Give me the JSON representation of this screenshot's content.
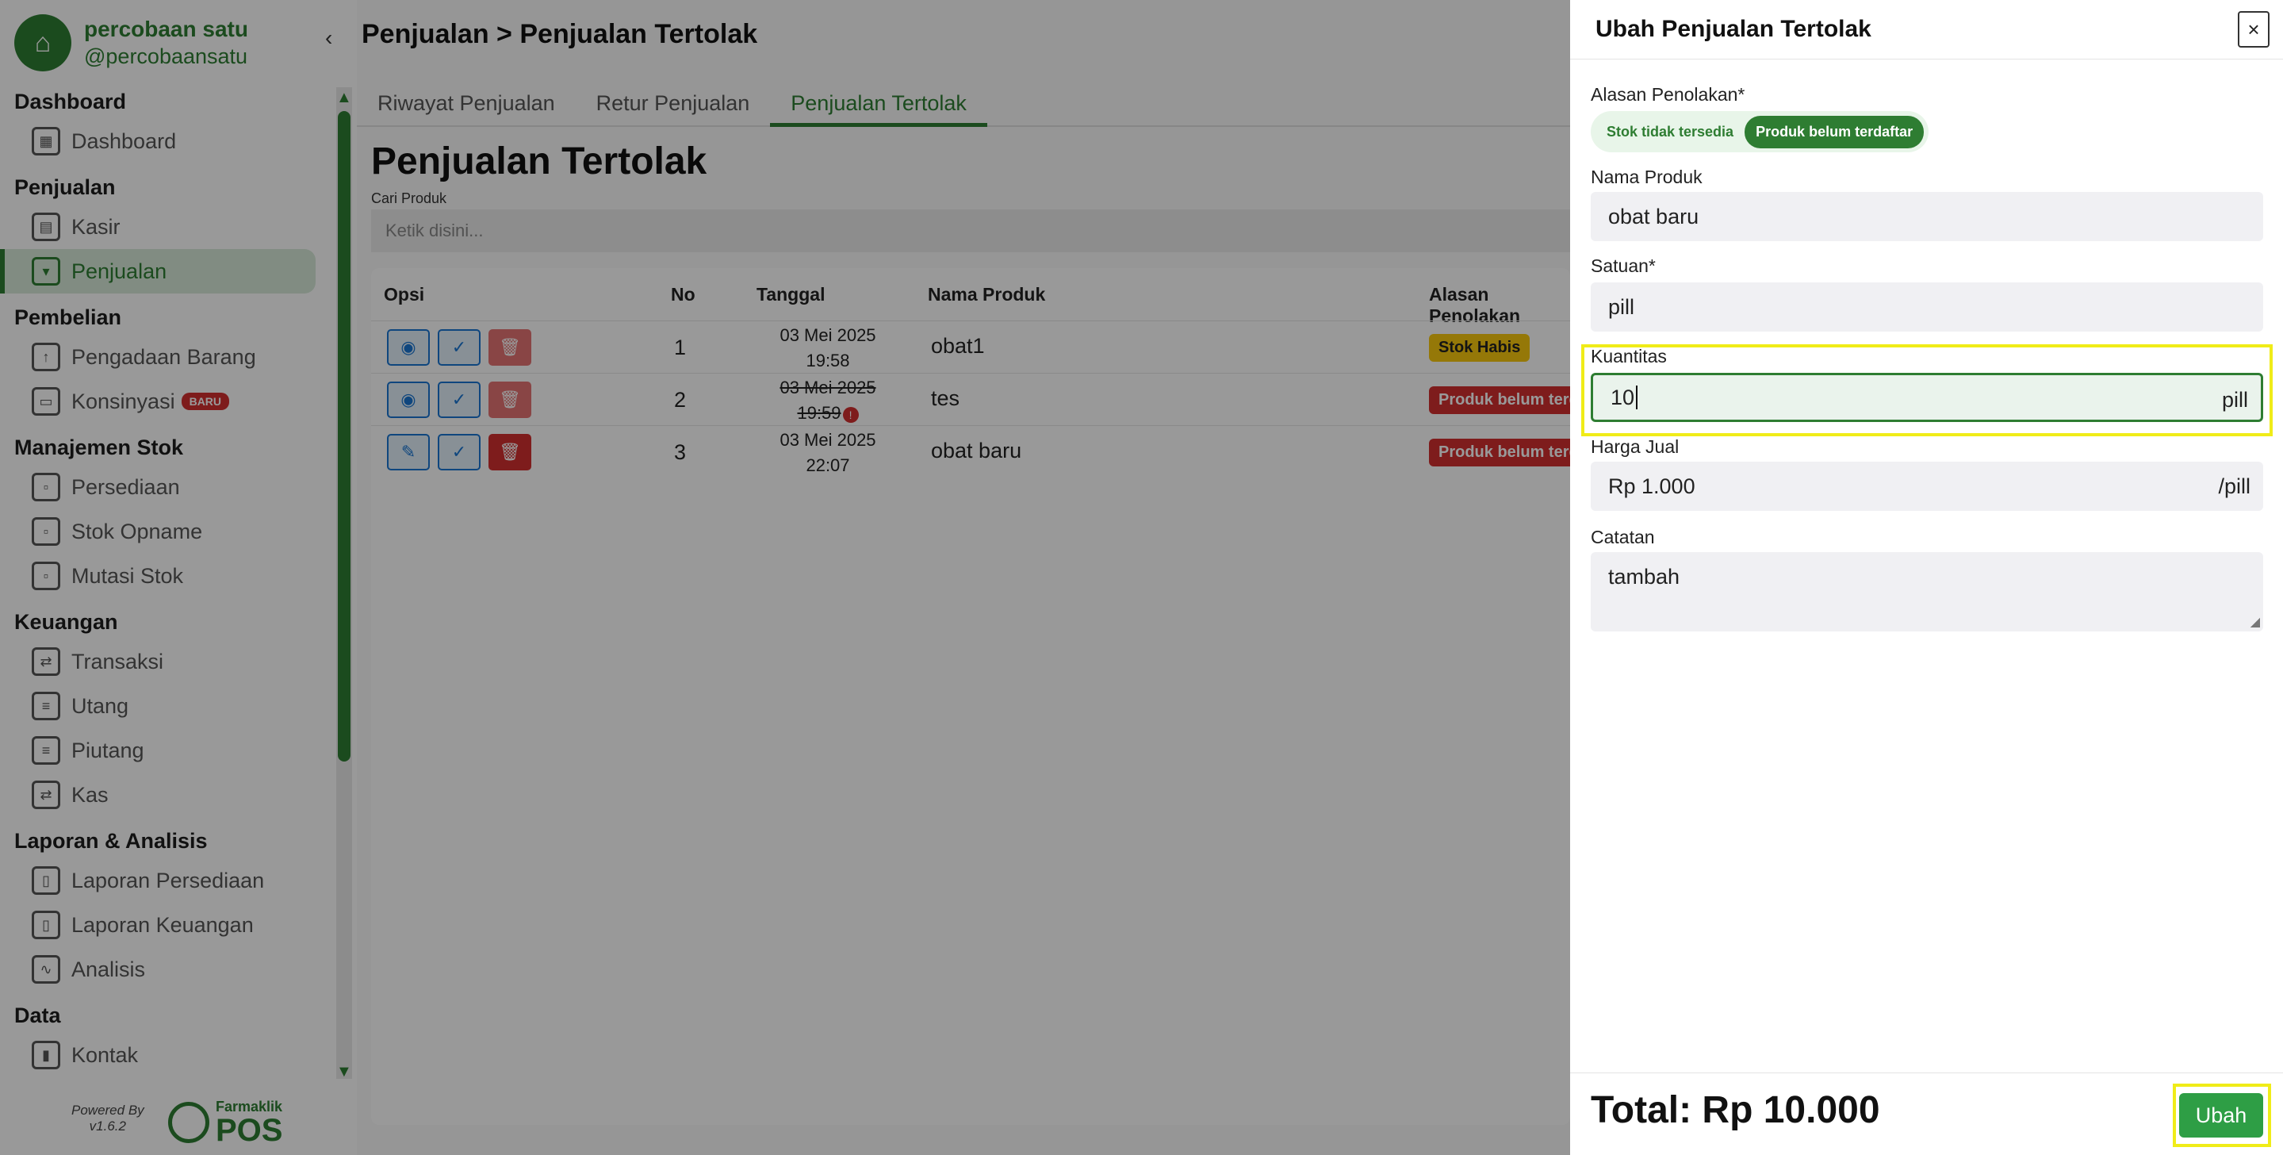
{
  "brand": {
    "name": "percobaan satu",
    "handle": "@percobaansatu"
  },
  "sidebar": {
    "groups": [
      {
        "title": "Dashboard",
        "items": [
          {
            "label": "Dashboard"
          }
        ]
      },
      {
        "title": "Penjualan",
        "items": [
          {
            "label": "Kasir"
          },
          {
            "label": "Penjualan",
            "active": true
          }
        ]
      },
      {
        "title": "Pembelian",
        "items": [
          {
            "label": "Pengadaan Barang"
          },
          {
            "label": "Konsinyasi",
            "badge": "BARU"
          }
        ]
      },
      {
        "title": "Manajemen Stok",
        "items": [
          {
            "label": "Persediaan"
          },
          {
            "label": "Stok Opname"
          },
          {
            "label": "Mutasi Stok"
          }
        ]
      },
      {
        "title": "Keuangan",
        "items": [
          {
            "label": "Transaksi"
          },
          {
            "label": "Utang"
          },
          {
            "label": "Piutang"
          },
          {
            "label": "Kas"
          }
        ]
      },
      {
        "title": "Laporan & Analisis",
        "items": [
          {
            "label": "Laporan Persediaan"
          },
          {
            "label": "Laporan Keuangan"
          },
          {
            "label": "Analisis"
          }
        ]
      },
      {
        "title": "Data",
        "items": [
          {
            "label": "Kontak"
          }
        ]
      }
    ],
    "powered_by": "Powered By",
    "version": "v1.6.2",
    "powered_logo_top": "Farmaklik",
    "powered_logo_bottom": "POS"
  },
  "header": {
    "breadcrumb": "Penjualan > Penjualan Tertolak"
  },
  "tabs": [
    {
      "label": "Riwayat Penjualan"
    },
    {
      "label": "Retur Penjualan"
    },
    {
      "label": "Penjualan Tertolak",
      "active": true
    }
  ],
  "main": {
    "title": "Penjualan Tertolak",
    "search_label": "Cari Produk",
    "search_placeholder": "Ketik disini..."
  },
  "table": {
    "headers": {
      "opsi": "Opsi",
      "no": "No",
      "tanggal": "Tanggal",
      "nama": "Nama Produk",
      "alasan": "Alasan Penolakan"
    },
    "rows": [
      {
        "no": "1",
        "date": "03 Mei 2025",
        "time": "19:58",
        "name": "obat1",
        "reason": "Stok Habis",
        "reason_color": "#f9c80e"
      },
      {
        "no": "2",
        "date": "03 Mei 2025",
        "time": "19:59",
        "name": "tes",
        "reason": "Produk belum terdaftar",
        "reason_color": "#d32f2f"
      },
      {
        "no": "3",
        "date": "03 Mei 2025",
        "time": "22:07",
        "name": "obat baru",
        "reason": "Produk belum terdaftar",
        "reason_color": "#d32f2f"
      }
    ]
  },
  "drawer": {
    "title": "Ubah Penjualan Tertolak",
    "reason_label": "Alasan Penolakan*",
    "reason_options": [
      "Stok tidak tersedia",
      "Produk belum terdaftar"
    ],
    "reason_selected": "Produk belum terdaftar",
    "product_label": "Nama Produk",
    "product_value": "obat baru",
    "unit_label": "Satuan*",
    "unit_value": "pill",
    "qty_label": "Kuantitas",
    "qty_value": "10",
    "qty_suffix": "pill",
    "price_label": "Harga Jual",
    "price_value": "Rp 1.000",
    "price_suffix": "/pill",
    "notes_label": "Catatan",
    "notes_value": "tambah",
    "total": "Total: Rp 10.000",
    "submit_label": "Ubah"
  },
  "colors": {
    "accent": "#2e7d32",
    "danger": "#d32f2f",
    "warning": "#f9c80e",
    "highlight": "#f0ec18"
  }
}
